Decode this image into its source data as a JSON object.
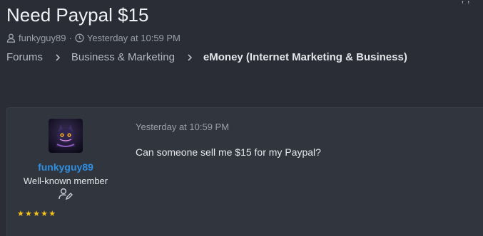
{
  "thread": {
    "title": "Need Paypal $15",
    "author": "funkyguy89",
    "separator": "·",
    "posted": "Yesterday at 10:59 PM"
  },
  "breadcrumb": [
    {
      "label": "Forums"
    },
    {
      "label": "Business & Marketing"
    },
    {
      "label": "eMoney (Internet Marketing & Business)"
    }
  ],
  "post": {
    "username": "funkyguy89",
    "user_title": "Well-known member",
    "stars": "★★★★★",
    "date": "Yesterday at 10:59 PM",
    "body": "Can someone sell me $15 for my Paypal?"
  },
  "colors": {
    "background": "#2a2d35",
    "post_background": "#31353e",
    "username": "#2f8ee0",
    "stars": "#f5c518"
  },
  "icons": {
    "author": "user-icon",
    "date": "clock-icon",
    "separator": "chevron-right-icon",
    "badge": "user-edit-icon"
  }
}
